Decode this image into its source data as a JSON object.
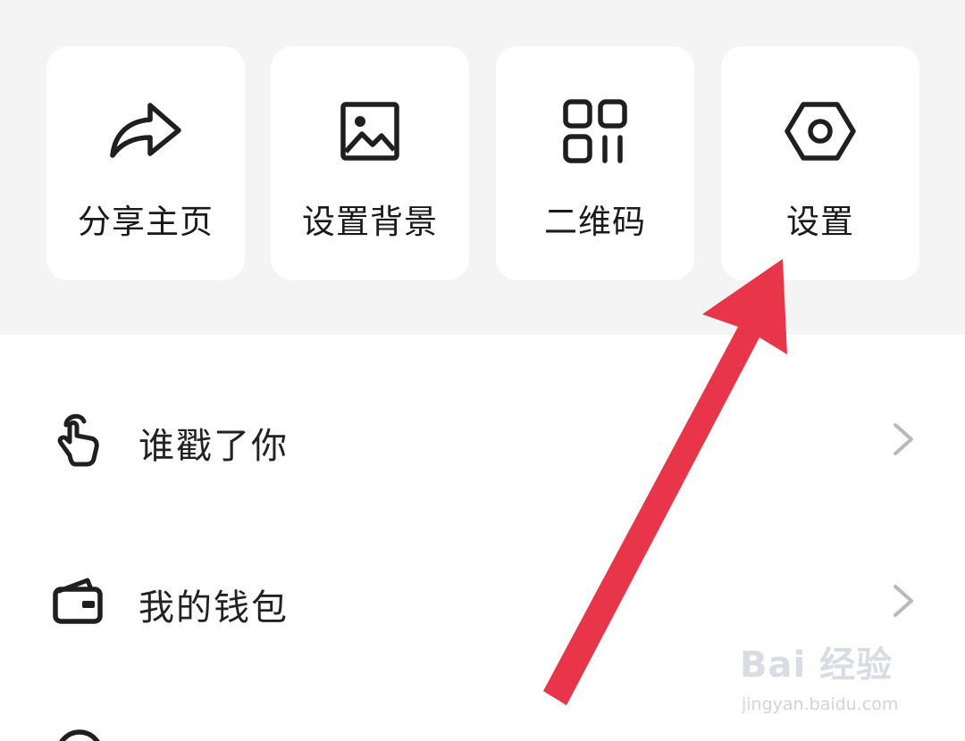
{
  "quick_actions": [
    {
      "label": "分享主页",
      "icon": "share-icon"
    },
    {
      "label": "设置背景",
      "icon": "image-icon"
    },
    {
      "label": "二维码",
      "icon": "qr-code-icon"
    },
    {
      "label": "设置",
      "icon": "settings-icon"
    }
  ],
  "menu_rows": [
    {
      "label": "谁戳了你",
      "icon": "poke-hand-icon"
    },
    {
      "label": "我的钱包",
      "icon": "wallet-icon"
    }
  ],
  "annotation": {
    "arrow_color": "#e8354a",
    "arrow_target": "设置"
  },
  "watermark": {
    "main": "Bai 经验",
    "paw": "du",
    "sub": "jingyan.baidu.com"
  },
  "colors": {
    "panel_bg": "#f4f4f5",
    "tile_bg": "#ffffff",
    "icon_color": "#1f1f1f",
    "chevron": "#b9b9b9"
  }
}
